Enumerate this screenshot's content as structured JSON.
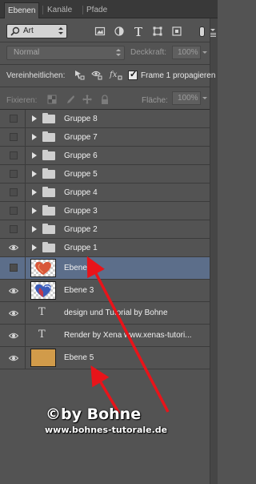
{
  "tabs": [
    {
      "label": "Ebenen",
      "active": true
    },
    {
      "label": "Kanäle",
      "active": false
    },
    {
      "label": "Pfade",
      "active": false
    }
  ],
  "filter": {
    "kind_label": "Art"
  },
  "blend": {
    "mode": "Normal",
    "opacity_label": "Deckkraft:",
    "opacity_value": "100%",
    "fill_label": "Fläche:",
    "fill_value": "100%"
  },
  "unify": {
    "label": "Vereinheitlichen:",
    "propagate_label": "Frame 1 propagieren",
    "propagate_checked": true
  },
  "lock": {
    "label": "Fixieren:"
  },
  "layers": [
    {
      "name": "Gruppe 8",
      "kind": "group",
      "visible": false
    },
    {
      "name": "Gruppe 7",
      "kind": "group",
      "visible": false
    },
    {
      "name": "Gruppe 6",
      "kind": "group",
      "visible": false
    },
    {
      "name": "Gruppe 5",
      "kind": "group",
      "visible": false
    },
    {
      "name": "Gruppe 4",
      "kind": "group",
      "visible": false
    },
    {
      "name": "Gruppe 3",
      "kind": "group",
      "visible": false
    },
    {
      "name": "Gruppe 2",
      "kind": "group",
      "visible": false
    },
    {
      "name": "Gruppe 1",
      "kind": "group",
      "visible": true
    },
    {
      "name": "Ebene 4",
      "kind": "image",
      "visible": false,
      "selected": true
    },
    {
      "name": "Ebene 3",
      "kind": "image",
      "visible": true
    },
    {
      "name": "design und Tutorial by Bohne",
      "kind": "text",
      "visible": true
    },
    {
      "name": "Render by Xena www.xenas-tutori...",
      "kind": "text",
      "visible": true
    },
    {
      "name": "Ebene 5",
      "kind": "fill",
      "visible": true
    }
  ],
  "watermark": {
    "line1": "©by Bohne",
    "line2": "www.bohnes-tutorale.de"
  },
  "colors": {
    "panel_bg": "#535353",
    "selected_row": "#5c6e8a",
    "arrow": "#e8141a",
    "fill_swatch": "#d19b4a"
  }
}
